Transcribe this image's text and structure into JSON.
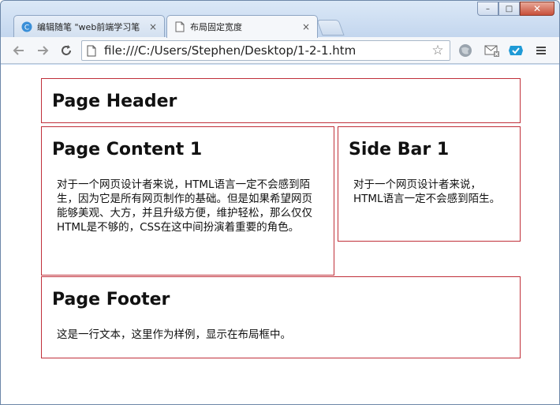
{
  "browser": {
    "tabs": [
      {
        "title": "编辑随笔 \"web前端学习笔",
        "close": "×",
        "icon": "blog-favicon-icon",
        "active": false
      },
      {
        "title": "布局固定宽度",
        "close": "×",
        "icon": "page-icon",
        "active": true
      }
    ],
    "window_controls": {
      "minimize": "–",
      "maximize": "□",
      "close": "✕"
    },
    "url": "file:///C:/Users/Stephen/Desktop/1-2-1.htm",
    "icons": {
      "back": "back-arrow-icon",
      "forward": "forward-arrow-icon",
      "reload": "reload-icon",
      "bookmark": "star-icon",
      "menu": "menu-icon"
    }
  },
  "page": {
    "header": {
      "title": "Page Header"
    },
    "content": {
      "title": "Page Content 1",
      "text": "对于一个网页设计者来说，HTML语言一定不会感到陌生，因为它是所有网页制作的基础。但是如果希望网页能够美观、大方，并且升级方便，维护轻松，那么仅仅HTML是不够的，CSS在这中间扮演着重要的角色。"
    },
    "sidebar": {
      "title": "Side Bar 1",
      "text": "对于一个网页设计者来说，HTML语言一定不会感到陌生。"
    },
    "footer": {
      "title": "Page Footer",
      "text": "这是一行文本，这里作为样例，显示在布局框中。"
    }
  },
  "colors": {
    "box_border": "#c0303a",
    "chrome_frame": "#c9dcf2",
    "toolbar_bg": "#f5f7fa"
  }
}
